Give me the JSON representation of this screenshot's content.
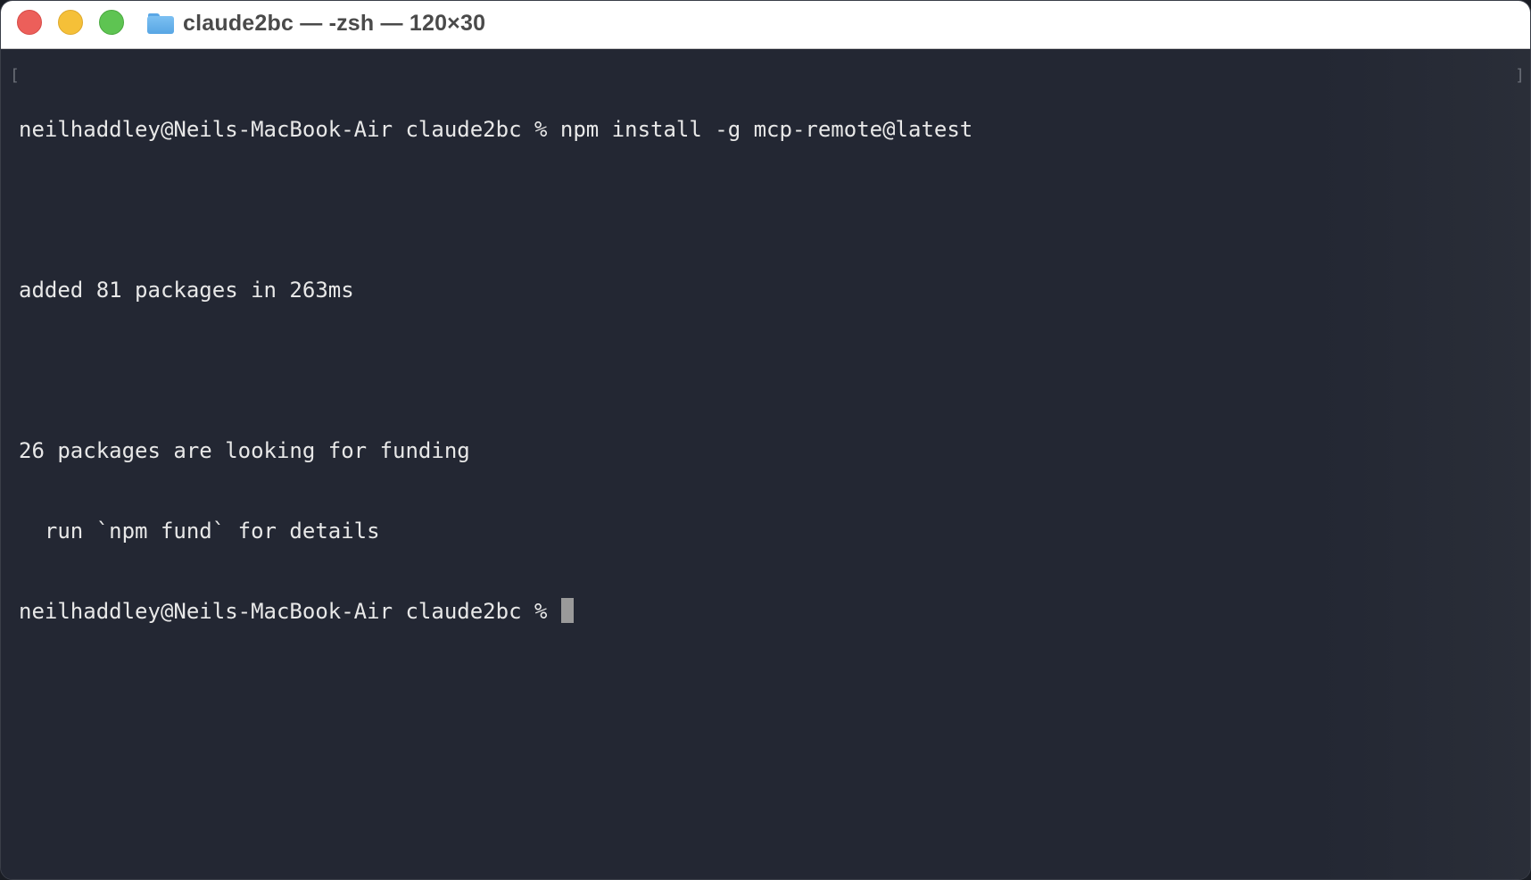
{
  "window": {
    "title": "claude2bc — -zsh — 120×30",
    "folder_icon": "folder-icon",
    "controls": [
      "close",
      "minimize",
      "zoom"
    ]
  },
  "terminal": {
    "lines": [
      "neilhaddley@Neils-MacBook-Air claude2bc % npm install -g mcp-remote@latest",
      "",
      "added 81 packages in 263ms",
      "",
      "26 packages are looking for funding",
      "  run `npm fund` for details",
      "neilhaddley@Neils-MacBook-Air claude2bc % "
    ],
    "mark_left": "[",
    "mark_right": "]"
  },
  "colors": {
    "background": "#232733",
    "text": "#e8e8e8",
    "close": "#ec5f5a",
    "minimize": "#f5c038",
    "zoom": "#5ec452"
  }
}
